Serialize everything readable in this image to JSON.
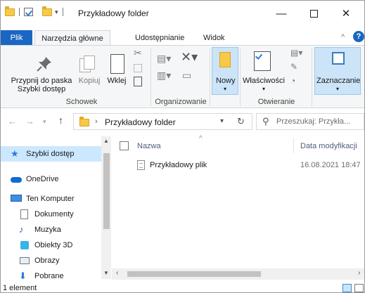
{
  "window": {
    "title": "Przykładowy folder",
    "minimize_icon": "minimize-icon",
    "maximize_icon": "maximize-icon",
    "close_label": "✕"
  },
  "ribbon_tabs": {
    "file": "Plik",
    "home": "Narzędzia główne",
    "share": "Udostępnianie",
    "view": "Widok"
  },
  "ribbon": {
    "pin_line1": "Przypnij do paska",
    "pin_line2": "Szybki dostęp",
    "copy": "Kopiuj",
    "paste": "Wklej",
    "clipboard_group": "Schowek",
    "new": "Nowy",
    "organize_group": "Organizowanie",
    "properties": "Właściwości",
    "open_group": "Otwieranie",
    "select": "Zaznaczanie"
  },
  "address": {
    "path": "Przykładowy folder",
    "search_placeholder": "Przeszukaj: Przykła..."
  },
  "sidebar": {
    "items": [
      {
        "label": "Szybki dostęp",
        "icon": "star-icon"
      },
      {
        "label": "OneDrive",
        "icon": "cloud-icon"
      },
      {
        "label": "Ten Komputer",
        "icon": "computer-icon"
      },
      {
        "label": "Dokumenty",
        "icon": "documents-icon"
      },
      {
        "label": "Muzyka",
        "icon": "music-icon"
      },
      {
        "label": "Obiekty 3D",
        "icon": "cube-3d-icon"
      },
      {
        "label": "Obrazy",
        "icon": "pictures-icon"
      },
      {
        "label": "Pobrane",
        "icon": "download-icon"
      }
    ]
  },
  "files": {
    "columns": [
      "Nazwa",
      "Data modyfikacji"
    ],
    "rows": [
      {
        "name": "Przykładowy plik",
        "modified": "16.08.2021 18:47"
      }
    ]
  },
  "status": {
    "count": "1 element"
  },
  "colors": {
    "accent": "#1a66c2",
    "selection": "#cce8ff",
    "folder": "#f7c948"
  }
}
